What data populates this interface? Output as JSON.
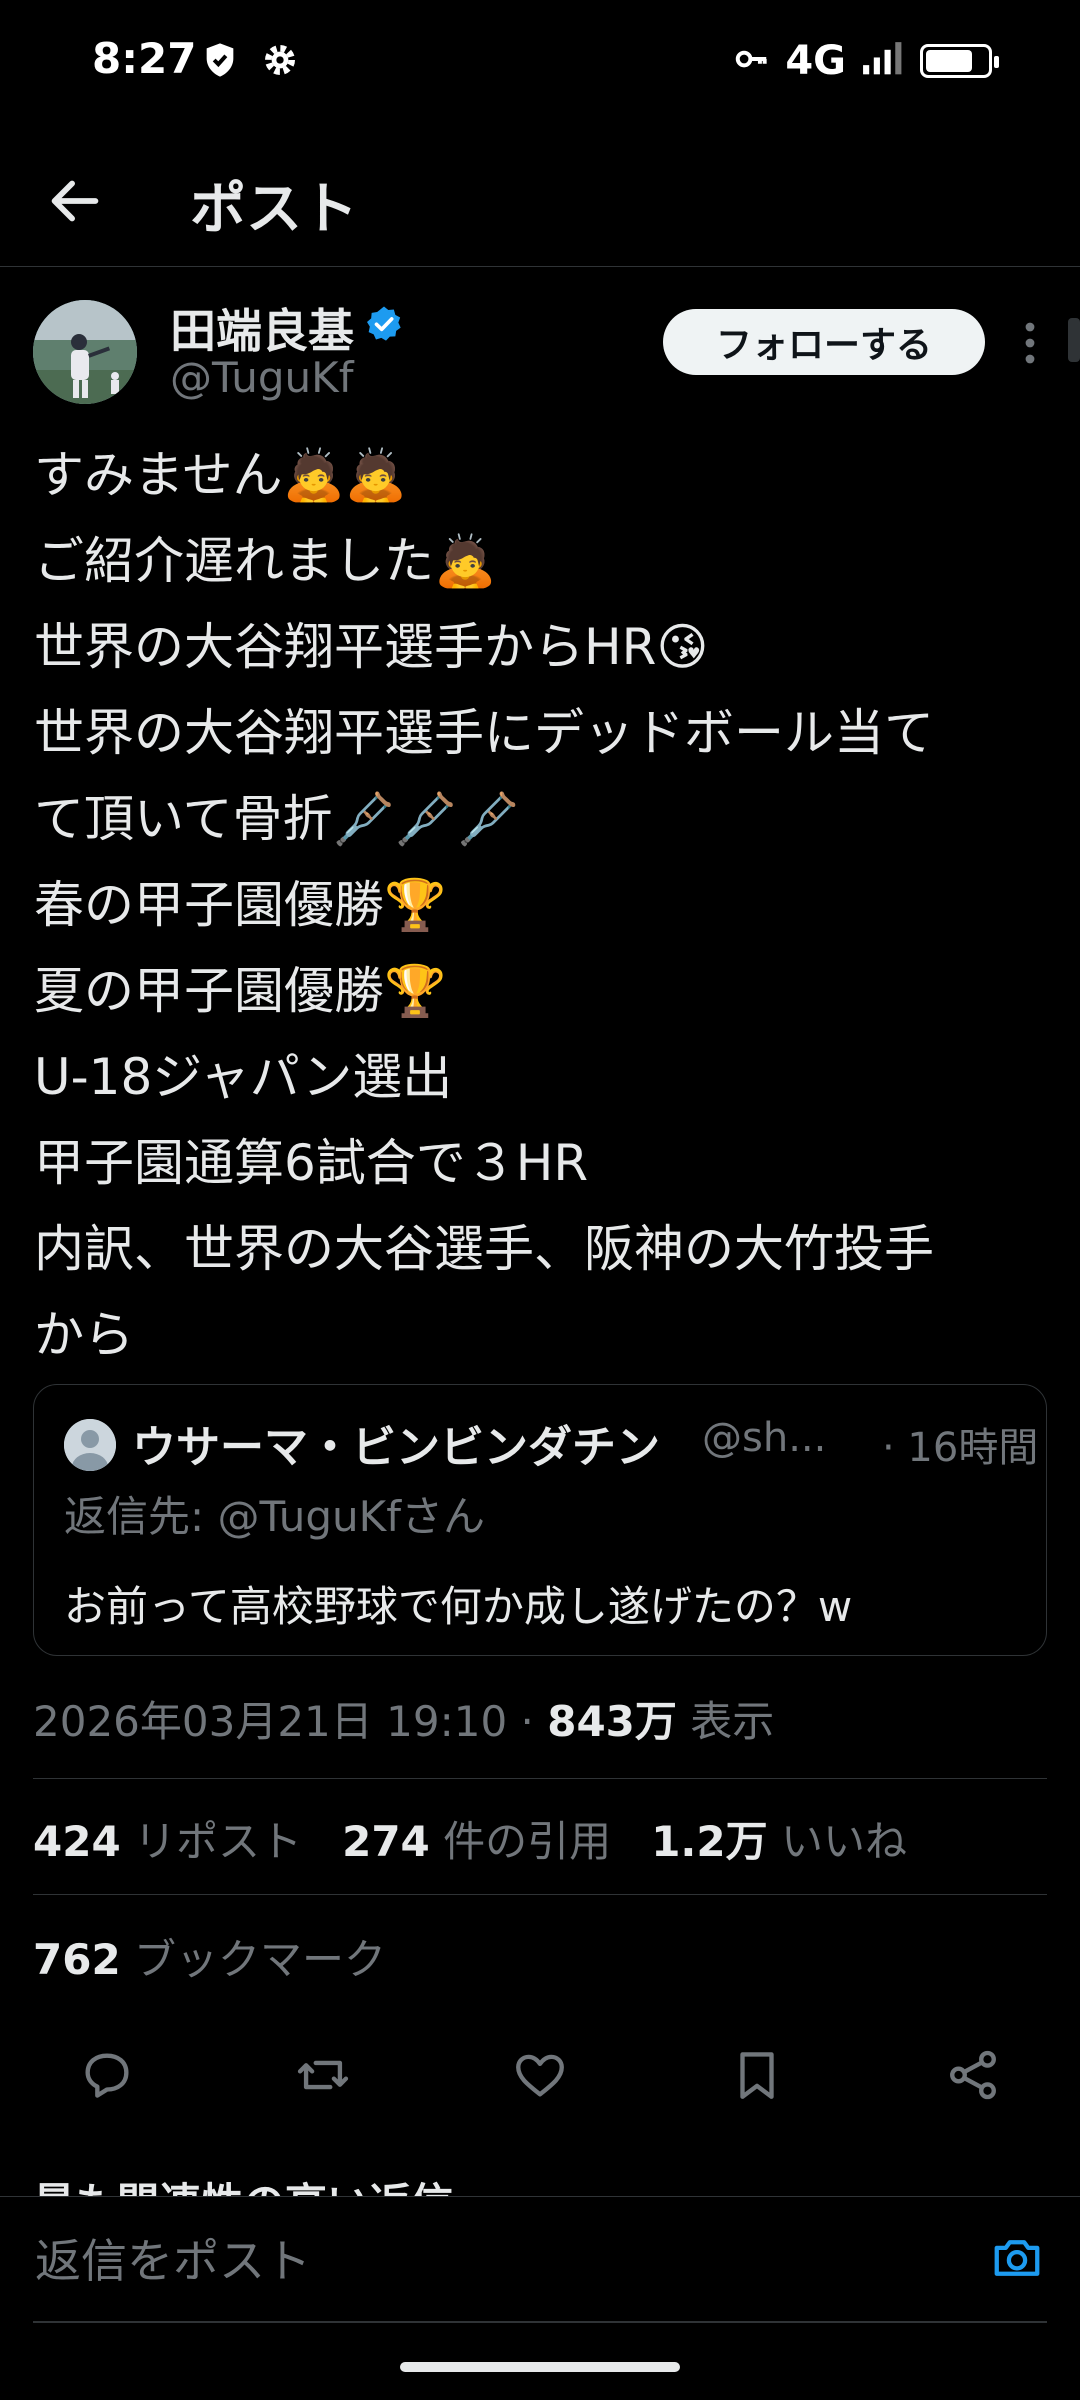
{
  "status_bar": {
    "time": "8:27",
    "network": "4G",
    "icons": [
      "shield-icon",
      "gear-icon",
      "key-icon",
      "signal-icon",
      "battery-icon"
    ]
  },
  "topbar": {
    "title": "ポスト",
    "back_icon": "arrow-left-icon"
  },
  "author": {
    "display_name": "田端良基",
    "handle": "@TuguKf",
    "verified": true,
    "follow_label": "フォローする"
  },
  "tweet": {
    "lines": [
      "すみません🙇🙇",
      "ご紹介遅れました🙇",
      "世界の大谷翔平選手からHR😘",
      "世界の大谷翔平選手にデッドボール当て",
      "て頂いて骨折🩼🩼🩼",
      "春の甲子園優勝🏆",
      "夏の甲子園優勝🏆",
      "U-18ジャパン選出",
      "甲子園通算6試合で３HR",
      "内訳、世界の大谷選手、阪神の大竹投手",
      "から"
    ]
  },
  "quote": {
    "name": "ウサーマ・ビンビンダチン",
    "handle": "@sh...",
    "time": "· 16時間",
    "reply_to": "返信先: @TuguKfさん",
    "text": "お前って高校野球で何か成し遂げたの？w"
  },
  "meta": {
    "timestamp": "2026年03月21日 19:10",
    "separator": " · ",
    "views_count": "843万",
    "views_label": " 表示"
  },
  "stats": {
    "reposts_count": "424",
    "reposts_label": " リポスト",
    "quotes_count": "274",
    "quotes_label": " 件の引用",
    "likes_count": "1.2万",
    "likes_label": " いいね",
    "bookmarks_count": "762",
    "bookmarks_label": " ブックマーク"
  },
  "actions": [
    "reply-icon",
    "repost-icon",
    "like-icon",
    "bookmark-icon",
    "share-icon"
  ],
  "related_label": "最も関連性の高い返信 ⌄",
  "reply_bar": {
    "placeholder": "返信をポスト"
  },
  "colors": {
    "background": "#000000",
    "text": "#e7e9ea",
    "muted": "#71767b",
    "accent": "#1d9bf0",
    "border": "#2f3336"
  }
}
